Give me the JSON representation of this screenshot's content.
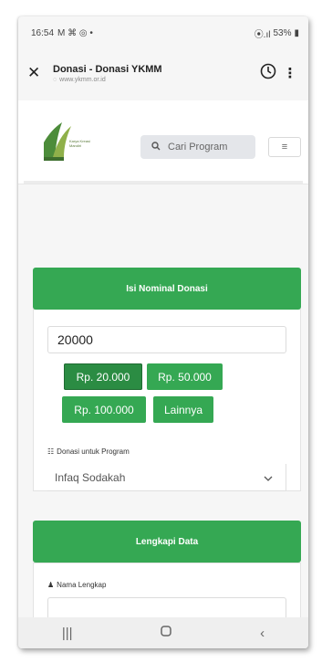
{
  "status_bar": {
    "time": "16:54",
    "left_icons": "M ⌘ ◎ •",
    "right_icons": "⦿.ıl",
    "battery": "53%"
  },
  "tab_bar": {
    "title": "Donasi - Donasi YKMM",
    "url": "www.ykmm.or.id"
  },
  "header": {
    "logo_text": "Karya Kreasi Mandiri",
    "search_placeholder": "Cari Program",
    "menu_icon": "≡"
  },
  "donation": {
    "section_title": "Isi Nominal Donasi",
    "amount_value": "20000",
    "presets": [
      {
        "label": "Rp. 20.000",
        "active": true
      },
      {
        "label": "Rp. 50.000",
        "active": false
      },
      {
        "label": "Rp. 100.000",
        "active": false
      },
      {
        "label": "Lainnya",
        "active": false
      }
    ],
    "program_label": "Donasi untuk Program",
    "program_selected": "Infaq Sodakah"
  },
  "data_section": {
    "section_title": "Lengkapi Data",
    "name_label": "Nama Lengkap"
  },
  "colors": {
    "accent": "#35a853",
    "accent_active": "#2b8c43"
  }
}
